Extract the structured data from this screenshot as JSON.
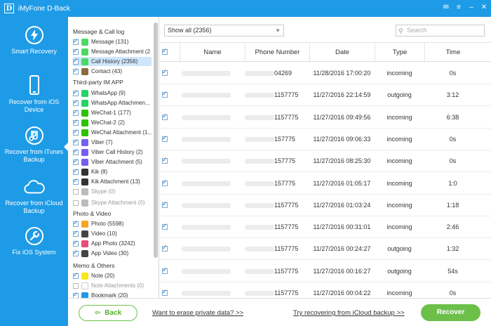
{
  "window": {
    "title": "iMyFone D-Back",
    "logo_letter": "D"
  },
  "nav": [
    {
      "label": "Smart Recovery",
      "icon": "lightning-icon"
    },
    {
      "label": "Recover from iOS Device",
      "icon": "phone-icon"
    },
    {
      "label": "Recover from iTunes Backup",
      "icon": "music-note-icon"
    },
    {
      "label": "Recover from iCloud Backup",
      "icon": "cloud-icon"
    },
    {
      "label": "Fix iOS System",
      "icon": "wrench-icon"
    }
  ],
  "tree": {
    "categories": [
      "Message & Call log",
      "Third-party IM APP",
      "Photo & Video",
      "Memo & Others"
    ],
    "items": [
      {
        "label": "Message (131)",
        "checked": true,
        "color": "#4cd964"
      },
      {
        "label": "Message Attachment (2",
        "checked": true,
        "color": "#4cd964"
      },
      {
        "label": "Call History (2356)",
        "checked": true,
        "color": "#4cd964"
      },
      {
        "label": "Contact (43)",
        "checked": true,
        "color": "#8b6a3e"
      },
      {
        "label": "WhatsApp (9)",
        "checked": true,
        "color": "#25d366"
      },
      {
        "label": "WhatsApp Attachmen...",
        "checked": true,
        "color": "#25d366"
      },
      {
        "label": "WeChat-1 (177)",
        "checked": true,
        "color": "#2dc100"
      },
      {
        "label": "WeChat-2 (2)",
        "checked": true,
        "color": "#2dc100"
      },
      {
        "label": "WeChat Attachment (1...",
        "checked": true,
        "color": "#2dc100"
      },
      {
        "label": "Viber (7)",
        "checked": true,
        "color": "#7360f2"
      },
      {
        "label": "Viber Call History (2)",
        "checked": true,
        "color": "#7360f2"
      },
      {
        "label": "Viber Attachment (5)",
        "checked": true,
        "color": "#7360f2"
      },
      {
        "label": "Kik (8)",
        "checked": true,
        "color": "#333333"
      },
      {
        "label": "Kik Attachment (13)",
        "checked": true,
        "color": "#333333"
      },
      {
        "label": "Skype (0)",
        "checked": false,
        "color": "#bbbbbb"
      },
      {
        "label": "Skype Attachment (0)",
        "checked": false,
        "color": "#bbbbbb"
      },
      {
        "label": "Photo (5598)",
        "checked": true,
        "color": "#f5a623"
      },
      {
        "label": "Video (10)",
        "checked": true,
        "color": "#444444"
      },
      {
        "label": "App Photo (3242)",
        "checked": true,
        "color": "#e94e77"
      },
      {
        "label": "App Video (30)",
        "checked": true,
        "color": "#444444"
      },
      {
        "label": "Note (20)",
        "checked": true,
        "color": "#f8e71c"
      },
      {
        "label": "Note Attachments (0)",
        "checked": false,
        "color": "#ffffff"
      },
      {
        "label": "Bookmark (20)",
        "checked": true,
        "color": "#1e9be6"
      }
    ]
  },
  "toolbar": {
    "filter_value": "Show all (2356)",
    "search_placeholder": "Search"
  },
  "table": {
    "columns": [
      "Name",
      "Phone Number",
      "Date",
      "Type",
      "Time"
    ],
    "rows": [
      {
        "phone": "04269",
        "date": "11/28/2016 17:00:20",
        "type": "incoming",
        "time": "0s"
      },
      {
        "phone": "1157775",
        "date": "11/27/2016 22:14:59",
        "type": "outgoing",
        "time": "3:12"
      },
      {
        "phone": "1157775",
        "date": "11/27/2016 09:49:56",
        "type": "incoming",
        "time": "6:38"
      },
      {
        "phone": "157775",
        "date": "11/27/2016 09:06:33",
        "type": "incoming",
        "time": "0s"
      },
      {
        "phone": "157775",
        "date": "11/27/2016 08:25:30",
        "type": "incoming",
        "time": "0s"
      },
      {
        "phone": "157775",
        "date": "11/27/2016 01:05:17",
        "type": "incoming",
        "time": "1:0"
      },
      {
        "phone": "1157775",
        "date": "11/27/2016 01:03:24",
        "type": "incoming",
        "time": "1:18"
      },
      {
        "phone": "1157775",
        "date": "11/27/2016 00:31:01",
        "type": "incoming",
        "time": "2:46"
      },
      {
        "phone": "1157775",
        "date": "11/27/2016 00:24:27",
        "type": "outgoing",
        "time": "1:32"
      },
      {
        "phone": "1157775",
        "date": "11/27/2016 00:16:27",
        "type": "outgoing",
        "time": "54s"
      },
      {
        "phone": "1157775",
        "date": "11/27/2016 00:04:22",
        "type": "incoming",
        "time": "0s"
      }
    ]
  },
  "footer": {
    "back_label": "Back",
    "erase_link": "Want to erase private data? >>",
    "icloud_link": "Try recovering from iCloud backup >>",
    "recover_label": "Recover"
  }
}
